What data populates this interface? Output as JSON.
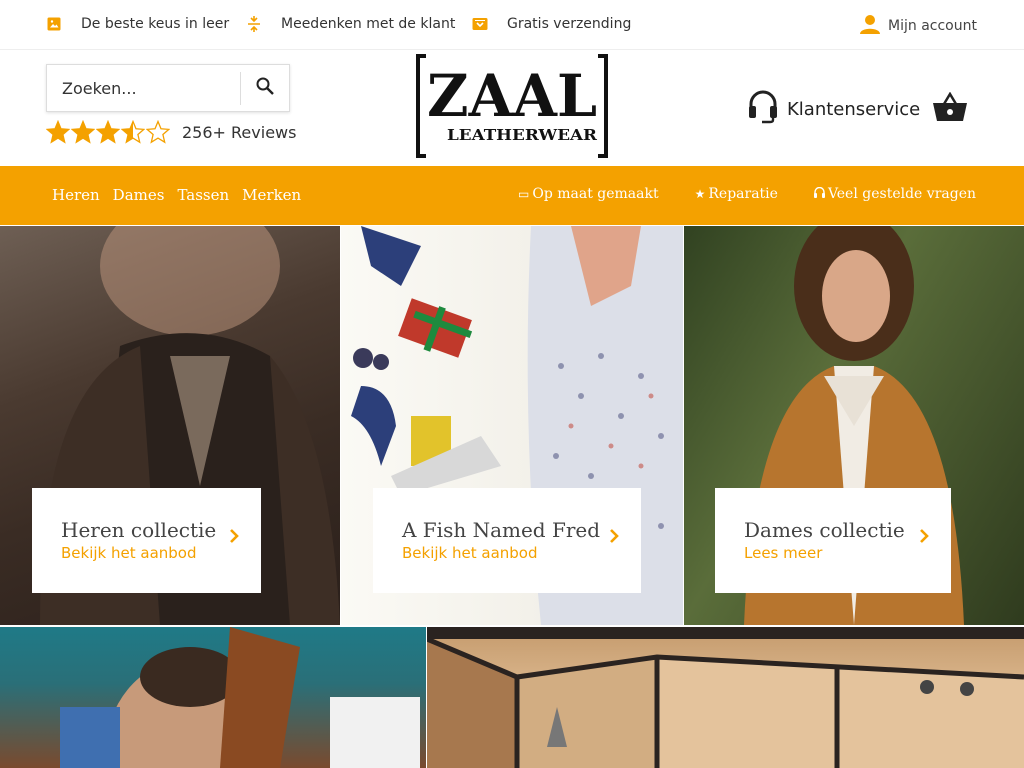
{
  "usp": [
    {
      "label": "De beste keus in leer",
      "icon": "image-icon"
    },
    {
      "label": "Meedenken met de klant",
      "icon": "split-icon"
    },
    {
      "label": "Gratis verzending",
      "icon": "shipping-icon"
    }
  ],
  "account": {
    "label": "Mijn account",
    "icon": "user-icon"
  },
  "search": {
    "placeholder": "Zoeken...",
    "icon": "search-icon"
  },
  "reviews": {
    "rating": 3.5,
    "max": 5,
    "count_label": "256+ Reviews"
  },
  "logo": {
    "line1": "ZAAL",
    "line2": "LEATHERWEAR"
  },
  "service": {
    "label": "Klantenservice",
    "icon": "headset-icon"
  },
  "basket": {
    "icon": "basket-icon"
  },
  "nav": {
    "left": [
      "Heren",
      "Dames",
      "Tassen",
      "Merken"
    ],
    "right": [
      {
        "label": "Op maat gemaakt",
        "glyph": "▭"
      },
      {
        "label": "Reparatie",
        "glyph": "★"
      },
      {
        "label": "Veel gestelde vragen",
        "glyph": "🎧"
      }
    ]
  },
  "tiles": [
    {
      "title": "Heren collectie",
      "sub": "Bekijk het aanbod"
    },
    {
      "title": "A Fish Named Fred",
      "sub": "Bekijk het aanbod"
    },
    {
      "title": "Dames collectie",
      "sub": "Lees meer"
    }
  ],
  "colors": {
    "accent": "#f4a100",
    "text": "#222222"
  }
}
